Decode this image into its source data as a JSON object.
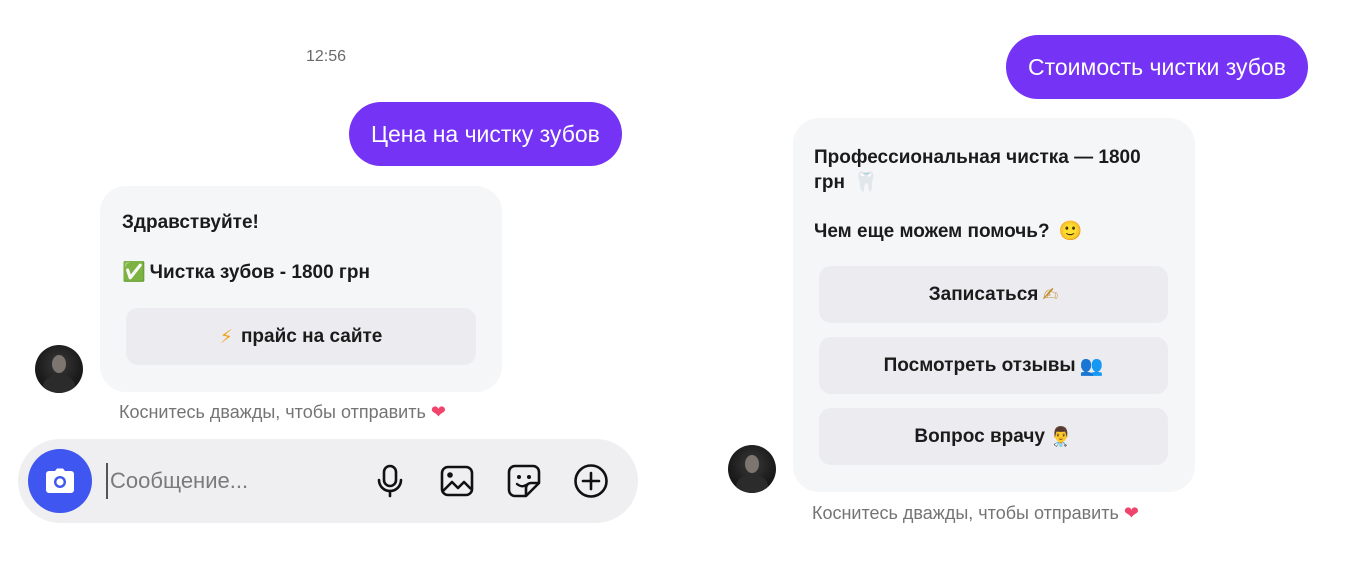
{
  "left_chat": {
    "timestamp": "12:56",
    "sent_message": "Цена на чистку зубов",
    "reply": {
      "greeting": "Здравствуйте!",
      "check_emoji": "✅",
      "price_line": "Чистка зубов - 1800 грн",
      "button": {
        "emoji": "⚡",
        "label": "прайс на сайте"
      }
    },
    "hint": "Коснитесь дважды, чтобы отправить",
    "hint_emoji": "❤"
  },
  "composer": {
    "placeholder": "Сообщение...",
    "icons": [
      "camera-icon",
      "microphone-icon",
      "gallery-icon",
      "sticker-icon",
      "plus-icon"
    ],
    "camera_color": "#3f56f0"
  },
  "right_chat": {
    "sent_message": "Стоимость чистки зубов",
    "reply": {
      "line1": "Профессиональная чистка — 1800",
      "line2": "грн",
      "line2_emoji": "🦷",
      "question": "Чем еще можем помочь?",
      "question_emoji": "🙂",
      "buttons": [
        {
          "label": "Записаться",
          "emoji": "✍"
        },
        {
          "label": "Посмотреть отзывы",
          "emoji": "👥"
        },
        {
          "label": "Вопрос врачу",
          "emoji": "👨‍⚕️"
        }
      ]
    },
    "hint": "Коснитесь дважды, чтобы отправить",
    "hint_emoji": "❤"
  },
  "colors": {
    "sent_bubble": "#7433f5",
    "card_background": "#f5f6f8",
    "quick_button": "#ececf0",
    "heart": "#f0446c"
  }
}
